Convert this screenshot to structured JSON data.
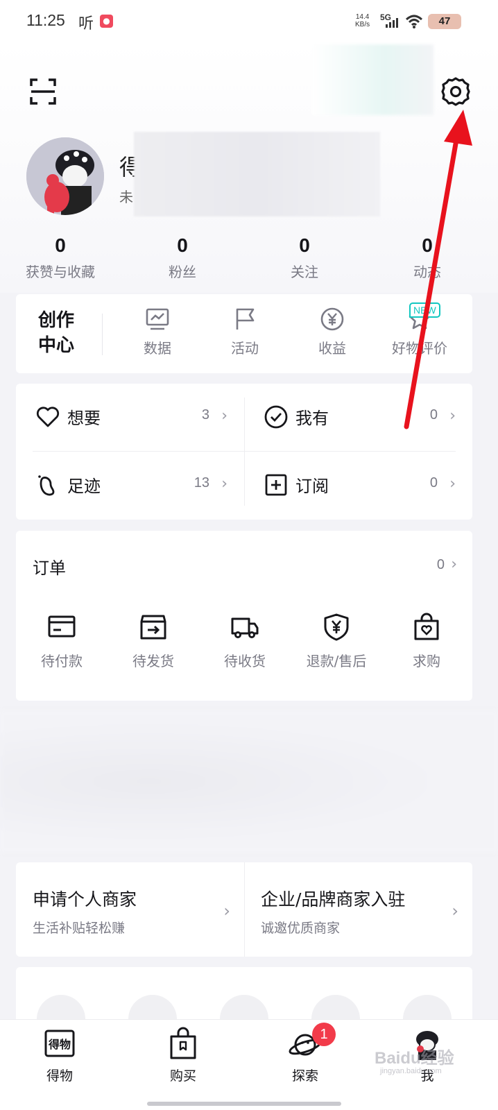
{
  "status_bar": {
    "time": "11:25",
    "listen": "听",
    "net_speed": "14.4",
    "net_unit": "KB/s",
    "signal": "5G",
    "battery": "47"
  },
  "profile": {
    "name_visible": "得",
    "sub_visible": "未"
  },
  "stats": [
    {
      "value": "0",
      "label": "获赞与收藏"
    },
    {
      "value": "0",
      "label": "粉丝"
    },
    {
      "value": "0",
      "label": "关注"
    },
    {
      "value": "0",
      "label": "动态"
    }
  ],
  "creation_center": {
    "title_line1": "创作",
    "title_line2": "中心",
    "items": [
      {
        "label": "数据",
        "icon": "chart-icon"
      },
      {
        "label": "活动",
        "icon": "flag-icon"
      },
      {
        "label": "收益",
        "icon": "yen-icon"
      },
      {
        "label": "好物评价",
        "icon": "star-icon"
      }
    ],
    "new_badge": "NEW"
  },
  "collections": [
    {
      "label": "想要",
      "count": "3",
      "icon": "heart-icon"
    },
    {
      "label": "我有",
      "count": "0",
      "icon": "check-circle-icon"
    },
    {
      "label": "足迹",
      "count": "13",
      "icon": "footprint-icon"
    },
    {
      "label": "订阅",
      "count": "0",
      "icon": "plus-square-icon"
    }
  ],
  "orders": {
    "title": "订单",
    "count": "0",
    "items": [
      {
        "label": "待付款",
        "icon": "card-icon"
      },
      {
        "label": "待发货",
        "icon": "box-icon"
      },
      {
        "label": "待收货",
        "icon": "truck-icon"
      },
      {
        "label": "退款/售后",
        "icon": "shield-yen-icon"
      },
      {
        "label": "求购",
        "icon": "bag-heart-icon"
      }
    ]
  },
  "merchant": {
    "personal_title": "申请个人商家",
    "personal_sub": "生活补贴轻松赚",
    "enterprise_title": "企业/品牌商家入驻",
    "enterprise_sub": "诚邀优质商家"
  },
  "bottom_nav": [
    {
      "label": "得物",
      "icon": "dewu-logo-icon"
    },
    {
      "label": "购买",
      "icon": "shopping-bag-icon"
    },
    {
      "label": "探索",
      "icon": "planet-icon",
      "badge": "1"
    },
    {
      "label": "我",
      "icon": "avatar-icon"
    }
  ],
  "watermark": {
    "text": "Baidu经验",
    "url": "jingyan.baidu.com"
  },
  "colors": {
    "accent_teal": "#11c7c0",
    "badge_red": "#f23b4a",
    "annotation_red": "#e8121d"
  }
}
